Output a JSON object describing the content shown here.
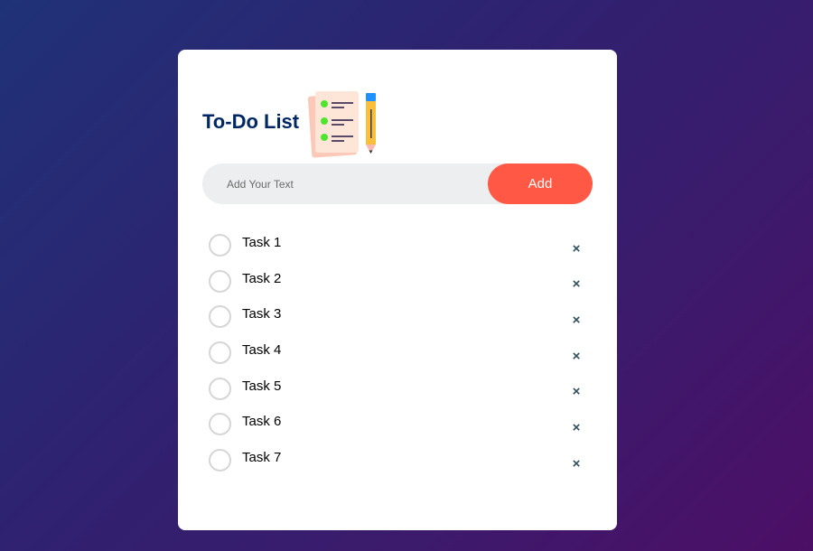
{
  "app": {
    "title": "To-Do List",
    "icon": "checklist-pencil-icon"
  },
  "input": {
    "placeholder": "Add Your Text",
    "value": ""
  },
  "add_button": {
    "label": "Add"
  },
  "tasks": [
    {
      "label": "Task 1",
      "checked": false
    },
    {
      "label": "Task 2",
      "checked": false
    },
    {
      "label": "Task 3",
      "checked": false
    },
    {
      "label": "Task 4",
      "checked": false
    },
    {
      "label": "Task 5",
      "checked": false
    },
    {
      "label": "Task 6",
      "checked": false
    },
    {
      "label": "Task 7",
      "checked": false
    }
  ],
  "delete_glyph": "×",
  "colors": {
    "title": "#002765",
    "accent": "#ff5945",
    "input_background": "#edeef0",
    "delete_icon": "#2f4f5c",
    "checkbox_border": "#d6d6d6"
  }
}
